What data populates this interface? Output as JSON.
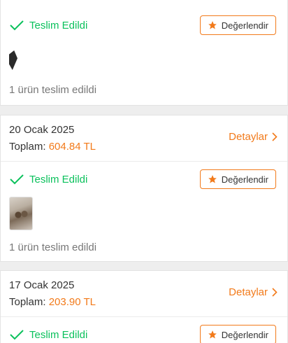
{
  "orders": [
    {
      "status": "Teslim Edildi",
      "rate_label": "Değerlendir",
      "delivered_text": "1 ürün teslim edildi"
    },
    {
      "date": "20 Ocak 2025",
      "total_label": "Toplam:",
      "total_amount": "604.84 TL",
      "details_label": "Detaylar",
      "status": "Teslim Edildi",
      "rate_label": "Değerlendir",
      "delivered_text": "1 ürün teslim edildi"
    },
    {
      "date": "17 Ocak 2025",
      "total_label": "Toplam:",
      "total_amount": "203.90 TL",
      "details_label": "Detaylar",
      "status": "Teslim Edildi",
      "rate_label": "Değerlendir"
    }
  ],
  "colors": {
    "accent": "#f27a1a",
    "success": "#0bc15c",
    "background": "#eeeeee"
  },
  "icons": {
    "status": "check-icon",
    "rate": "star-icon",
    "details": "chevron-right-icon"
  }
}
